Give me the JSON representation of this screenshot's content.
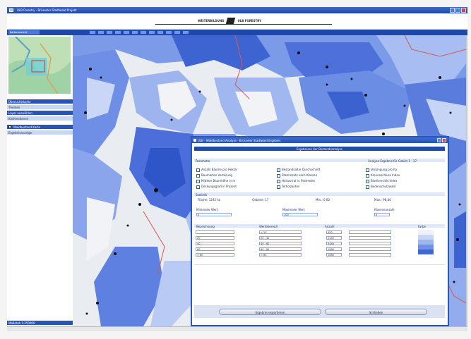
{
  "window": {
    "title": "ULB Forestry - Brüsseler Stadtwald Projekt",
    "icons": {
      "app": "map-app-icon",
      "minimize": "minimize-icon",
      "maximize": "maximize-icon",
      "close": "close-icon"
    }
  },
  "banner": {
    "brand_left": "WEITERBILDUNG",
    "brand_right": "ULB FORESTRY"
  },
  "toolbar": {
    "active_tab": "Kartenansicht"
  },
  "left_panel": {
    "rows": [
      {
        "label": "Übersichtskarte",
        "style": "dark"
      },
      {
        "label": "Themen",
        "style": "light"
      },
      {
        "label": "Layer auswählen",
        "style": "dark"
      },
      {
        "label": "Kartenebenen",
        "style": "light"
      },
      {
        "label": "Waldbestand Karte",
        "style": "dark"
      },
      {
        "label": "Ergebnisanzeige",
        "style": "light"
      }
    ],
    "status": "Maßstab 1:250000"
  },
  "dialog": {
    "title": "ULB - Waldbestand Analyse - Brüsseler Stadtwald Ergebnis",
    "header": "Ergebnisse der Bestandsanalyse",
    "section1": {
      "label": "Parameter",
      "right": "Analyse-Ergebnis für Gebiet 1 - 17"
    },
    "options": [
      "Anzahl Bäume pro Hektar",
      "Baumarten Verteilung",
      "Mittlere Baumhöhe in m",
      "Deckungsgrad in Prozent",
      "Bestandsalter Durchschnitt",
      "Stammzahl nach Klassen",
      "Holzvorrat in Festmeter",
      "Totholzanteil",
      "Verjüngung pro ha",
      "Kronenschluss Index",
      "Biodiversität Index",
      "Bodenschutzwald"
    ],
    "section2": {
      "label": "Statistik"
    },
    "stats": [
      {
        "k": "Fläche",
        "v": "1245 ha"
      },
      {
        "k": "Gebiete",
        "v": "17"
      },
      {
        "k": "Min.",
        "v": "0,00"
      },
      {
        "k": "Max.",
        "v": "98,40"
      }
    ],
    "groups": [
      {
        "label": "Minimaler Wert",
        "value": "0"
      },
      {
        "label": "Maximaler Wert",
        "value": "100"
      },
      {
        "label": "Klassenanzahl",
        "value": "5"
      }
    ],
    "table": {
      "headers": [
        "Bezeichnung",
        "Wertebereich",
        "Anzahl",
        "Farbe"
      ],
      "rows": [
        {
          "name": "",
          "range": "< 20",
          "count": "450"
        },
        {
          "name": "20",
          "range": "20 - 40",
          "count": "2145"
        },
        {
          "name": "40",
          "range": "40 - 60",
          "count": "3440"
        },
        {
          "name": "60",
          "range": "60 - 80",
          "count": "1980"
        },
        {
          "name": "> 80",
          "range": "> 80",
          "count": "1680"
        }
      ]
    },
    "legend_colors": [
      "#eef2fc",
      "#c8d5f6",
      "#9fb6ef",
      "#6f91e6",
      "#3f66d4"
    ],
    "buttons": {
      "left": "Ergebnis exportieren",
      "right": "Schließen"
    }
  }
}
